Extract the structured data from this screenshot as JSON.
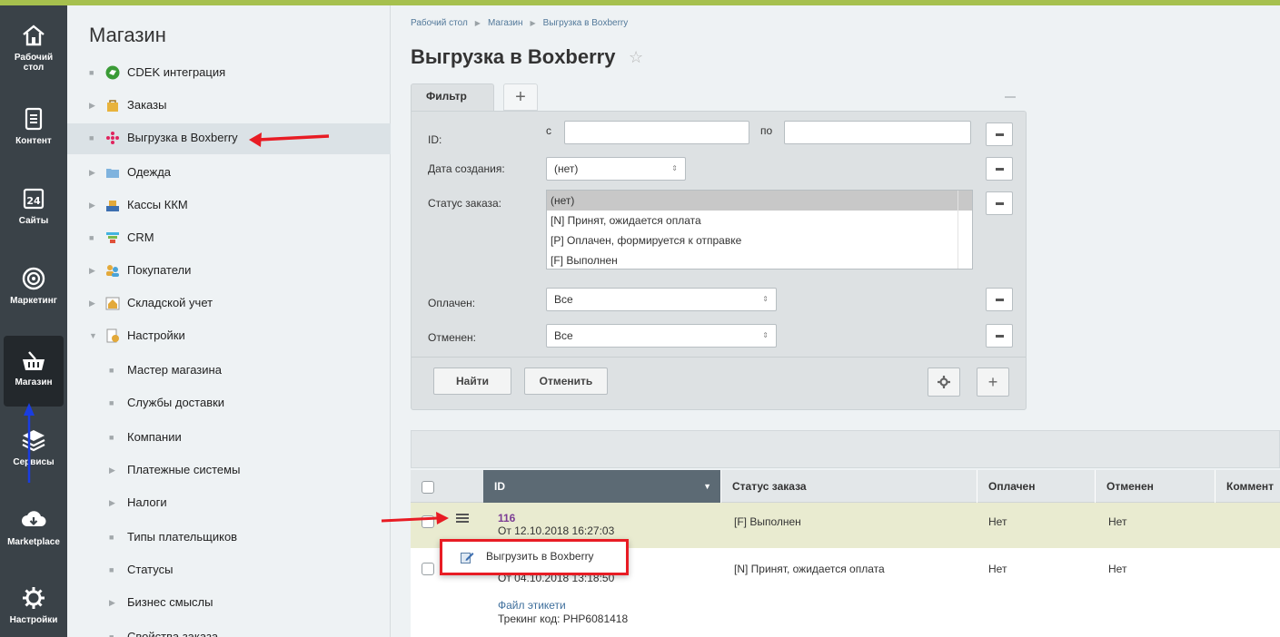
{
  "leftnav": {
    "items": [
      {
        "label": "Рабочий стол",
        "icon": "home-icon"
      },
      {
        "label": "Контент",
        "icon": "document-icon"
      },
      {
        "label": "Сайты",
        "icon": "calendar-icon"
      },
      {
        "label": "Маркетинг",
        "icon": "target-icon"
      },
      {
        "label": "Магазин",
        "icon": "basket-icon"
      },
      {
        "label": "Сервисы",
        "icon": "layers-icon"
      },
      {
        "label": "Marketplace",
        "icon": "cloud-download-icon"
      },
      {
        "label": "Настройки",
        "icon": "gear-icon"
      }
    ],
    "home_line1": "Рабочий",
    "home_line2": "стол"
  },
  "menu": {
    "title": "Магазин",
    "items": [
      {
        "label": "CDEK интеграция"
      },
      {
        "label": "Заказы"
      },
      {
        "label": "Выгрузка в Boxberry"
      },
      {
        "label": "Одежда"
      },
      {
        "label": "Кассы ККМ"
      },
      {
        "label": "CRM"
      },
      {
        "label": "Покупатели"
      },
      {
        "label": "Складской учет"
      },
      {
        "label": "Настройки"
      },
      {
        "label": "Мастер магазина"
      },
      {
        "label": "Службы доставки"
      },
      {
        "label": "Компании"
      },
      {
        "label": "Платежные системы"
      },
      {
        "label": "Налоги"
      },
      {
        "label": "Типы плательщиков"
      },
      {
        "label": "Статусы"
      },
      {
        "label": "Бизнес смыслы"
      },
      {
        "label": "Свойства заказа"
      }
    ]
  },
  "breadcrumb": {
    "items": [
      "Рабочий стол",
      "Магазин",
      "Выгрузка в Boxberry"
    ]
  },
  "page": {
    "title": "Выгрузка в Boxberry",
    "star": "☆"
  },
  "filter": {
    "tab_label": "Фильтр",
    "tab_add": "+",
    "id_label": "ID:",
    "from_label": "с",
    "to_label": "по",
    "id_from_value": "",
    "id_to_value": "",
    "created_label": "Дата создания:",
    "created_value": "(нет)",
    "status_label": "Статус заказа:",
    "status_options": [
      "(нет)",
      "[N] Принят, ожидается оплата",
      "[P] Оплачен, формируется к отправке",
      "[F] Выполнен"
    ],
    "paid_label": "Оплачен:",
    "paid_value": "Все",
    "canceled_label": "Отменен:",
    "canceled_value": "Все",
    "find_button": "Найти",
    "cancel_button": "Отменить",
    "add_button": "+"
  },
  "grid": {
    "columns": [
      "ID",
      "Статус заказа",
      "Оплачен",
      "Отменен",
      "Коммент"
    ],
    "rows": [
      {
        "id": "116",
        "date": "От 12.10.2018 16:27:03",
        "status": "[F] Выполнен",
        "paid": "Нет",
        "canceled": "Нет"
      },
      {
        "id": "",
        "date": "От 04.10.2018 13:18:50",
        "status": "[N] Принят, ожидается оплата",
        "paid": "Нет",
        "canceled": "Нет",
        "label_link": "Файл этикети",
        "tracking": "Трекинг код: PHP6081418"
      }
    ]
  },
  "popup": {
    "action_label": "Выгрузить в Boxberry"
  },
  "colors": {
    "accent": "#a6c04e",
    "annotation": "#e81c24",
    "annotation_blue": "#1a3de0"
  }
}
